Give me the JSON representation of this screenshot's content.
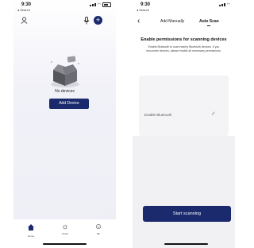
{
  "left_screen": {
    "status_time": "9:30",
    "back_app": "◂ Search",
    "empty_text": "No devices",
    "add_device_label": "Add Device",
    "tabs": [
      {
        "label": "Home",
        "icon": "home-icon",
        "glyph": "⌂"
      },
      {
        "label": "Smart",
        "icon": "sun-icon",
        "glyph": "☼"
      },
      {
        "label": "Me",
        "icon": "person-icon",
        "glyph": "☺"
      }
    ]
  },
  "right_screen": {
    "status_time": "9:30",
    "back_app": "◂ Search",
    "tab_manual": "Add Manually",
    "tab_auto": "Auto Scan",
    "perm_title": "Enable permissions for scanning devices",
    "perm_desc": "Enable Bluetooth to scan nearby Bluetooth devices. If you encounter devices, please enable all necessary permissions.",
    "bluetooth_label": "Enable Bluetooth",
    "start_label": "Start scanning"
  },
  "colors": {
    "accent": "#1a2a6c",
    "background": "#eeeef6"
  }
}
